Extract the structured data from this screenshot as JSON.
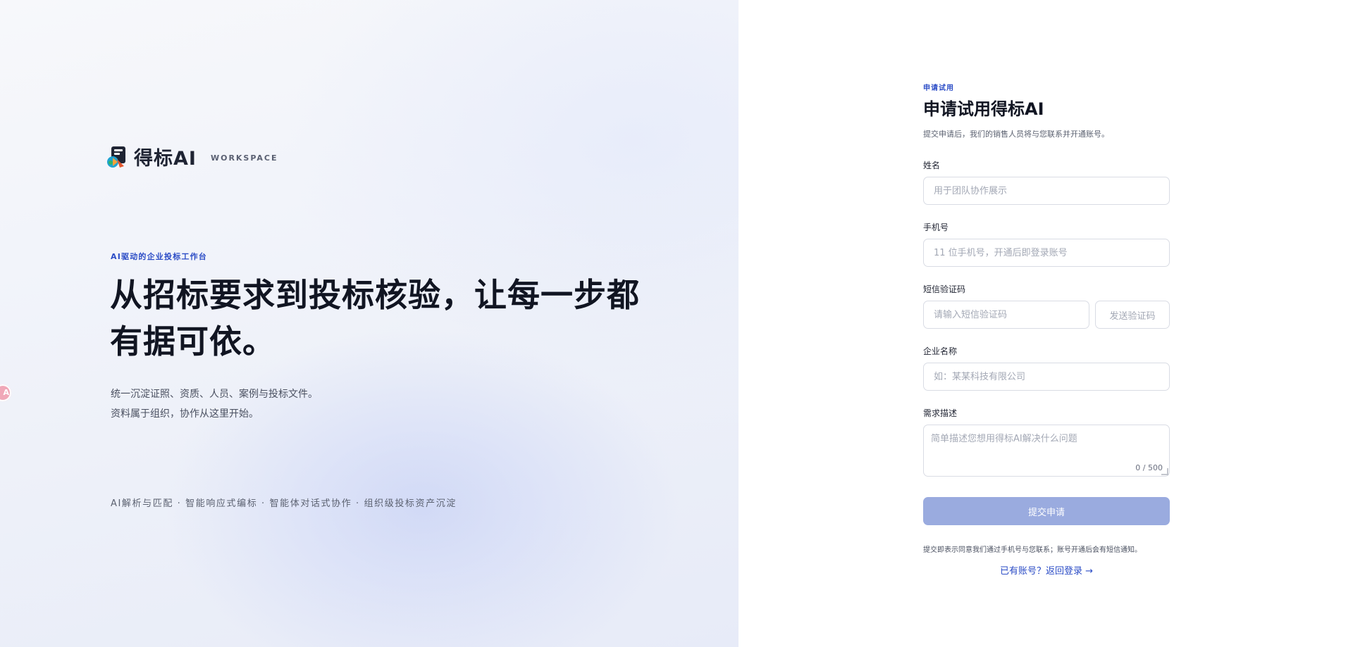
{
  "hero": {
    "brand": {
      "name": "得标AI",
      "tag": "WORKSPACE"
    },
    "eyebrow": "AI驱动的企业投标工作台",
    "headline": "从招标要求到投标核验，让每一步都有据可依。",
    "sub_lines": [
      "统一沉淀证照、资质、人员、案例与投标文件。",
      "资料属于组织，协作从这里开始。"
    ],
    "features": "AI解析与匹配 · 智能响应式编标 · 智能体对话式协作 · 组织级投标资产沉淀",
    "side_badge": "A"
  },
  "form": {
    "eyebrow": "申请试用",
    "title": "申请试用得标AI",
    "desc": "提交申请后，我们的销售人员将与您联系并开通账号。",
    "name": {
      "label": "姓名",
      "placeholder": "用于团队协作展示",
      "value": ""
    },
    "phone": {
      "label": "手机号",
      "placeholder": "11 位手机号，开通后即登录账号",
      "value": ""
    },
    "sms": {
      "label": "短信验证码",
      "placeholder": "请输入短信验证码",
      "value": "",
      "send_label": "发送验证码"
    },
    "company": {
      "label": "企业名称",
      "placeholder": "如：某某科技有限公司",
      "value": ""
    },
    "need": {
      "label": "需求描述",
      "placeholder": "简单描述您想用得标AI解决什么问题",
      "value": "",
      "counter": "0 / 500"
    },
    "submit_label": "提交申请",
    "agree_text": "提交即表示同意我们通过手机号与您联系；账号开通后会有短信通知。",
    "login_link": "已有账号？返回登录 →"
  },
  "colors": {
    "accent": "#2b4cc6",
    "submit_disabled": "#9aabdf",
    "text_dark": "#111522"
  }
}
